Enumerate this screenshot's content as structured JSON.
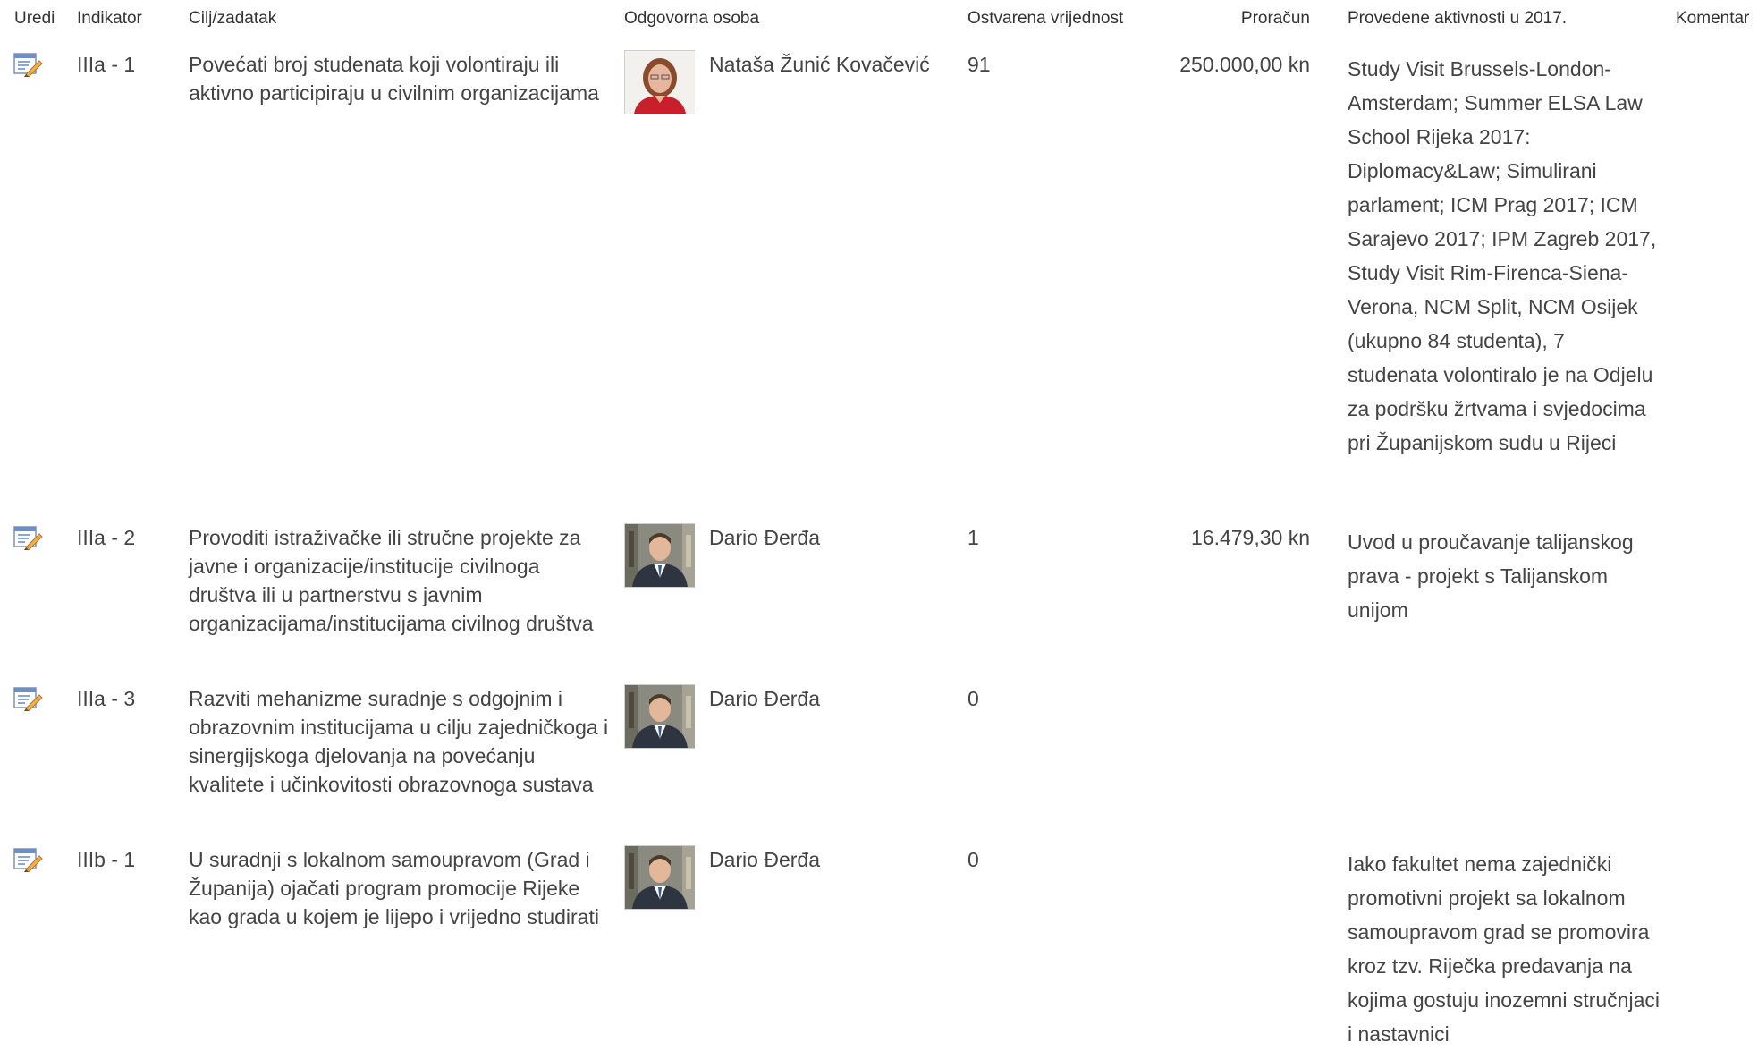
{
  "columns": {
    "edit": "Uredi",
    "indicator": "Indikator",
    "goal": "Cilj/zadatak",
    "responsible": "Odgovorna osoba",
    "value": "Ostvarena vrijednost",
    "budget": "Proračun",
    "activities": "Provedene aktivnosti u 2017.",
    "comment": "Komentar"
  },
  "rows": [
    {
      "indicator": "IIIa - 1",
      "goal": "Povećati broj studenata koji volontiraju ili aktivno participiraju u civilnim organizacijama",
      "person": "Nataša Žunić Kovačević",
      "value": "91",
      "budget": "250.000,00 kn",
      "activities": "Study Visit Brussels-London-Amsterdam; Summer ELSA Law School Rijeka 2017: Diplomacy&Law; Simulirani parlament; ICM Prag 2017; ICM Sarajevo 2017; IPM Zagreb 2017, Study Visit Rim-Firenca-Siena-Verona, NCM Split, NCM Osijek (ukupno 84 studenta), 7 studenata volontiralo je na Odjelu za podršku žrtvama i svjedocima pri Županijskom sudu u Rijeci"
    },
    {
      "indicator": "IIIa - 2",
      "goal": "Provoditi istraživačke ili stručne projekte za javne i organizacije/institucije civilnoga društva ili u partnerstvu s javnim organizacijama/institucijama civilnog društva",
      "person": "Dario Đerđa",
      "value": "1",
      "budget": "16.479,30 kn",
      "activities": "Uvod u proučavanje talijanskog prava - projekt s Talijanskom unijom"
    },
    {
      "indicator": "IIIa - 3",
      "goal": "Razviti mehanizme suradnje s odgojnim i obrazovnim institucijama u cilju zajedničkoga i sinergijskoga djelovanja na povećanju kvalitete i učinkovitosti obrazovnoga sustava",
      "person": "Dario Đerđa",
      "value": "0",
      "budget": "",
      "activities": ""
    },
    {
      "indicator": "IIIb - 1",
      "goal": "U suradnji s lokalnom samoupravom (Grad i Županija) ojačati program promocije Rijeke kao grada u kojem je lijepo i vrijedno studirati",
      "person": "Dario Đerđa",
      "value": "0",
      "budget": "",
      "activities": "Iako fakultet nema zajednički promotivni projekt sa lokalnom samoupravom grad se promovira kroz tzv. Riječka predavanja na kojima gostuju inozemni stručnjaci i nastavnici"
    }
  ],
  "icons": {
    "edit": "edit-document-icon",
    "photo_female": "person-photo-female",
    "photo_male": "person-photo-male"
  },
  "colors": {
    "text": "#444444",
    "header": "#333333",
    "edit_icon_blue": "#5b7db8",
    "edit_icon_pencil": "#e8a43c"
  }
}
